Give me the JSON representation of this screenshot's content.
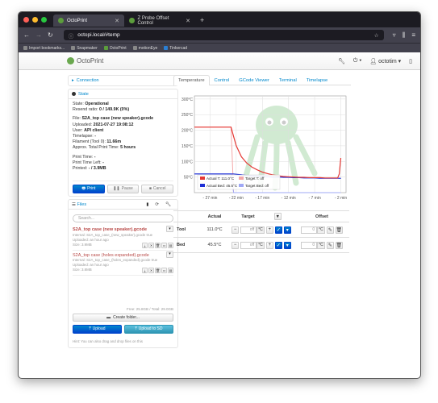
{
  "browser": {
    "tabs": [
      {
        "label": "OctoPrint"
      },
      {
        "label": "Z Probe Offset Control"
      }
    ],
    "url": "octopi.local/#temp",
    "bookmarks": [
      "Import bookmarks...",
      "Snapmaker",
      "OctoPrint",
      "motionEye",
      "Tinkercad"
    ]
  },
  "header": {
    "brand": "OctoPrint",
    "user": "octotim"
  },
  "sidebar": {
    "connection_title": "Connection",
    "state_title": "State",
    "state_lines": [
      {
        "label": "State: ",
        "value": "Operational"
      },
      {
        "label": "Resend ratio: ",
        "value": "0 / 149.9K (0%)"
      }
    ],
    "file_lines": [
      {
        "label": "File: ",
        "value": "S2A_top case (new speaker).gcode"
      },
      {
        "label": "Uploaded: ",
        "value": "2021-07-27 19:08:12"
      },
      {
        "label": "User: ",
        "value": "API client"
      },
      {
        "label": "Timelapse: ",
        "value": "-"
      },
      {
        "label": "Filament (Tool 0): ",
        "value": "11.66m"
      },
      {
        "label": "Approx. Total Print Time: ",
        "value": "5 hours"
      }
    ],
    "time_lines": [
      {
        "label": "Print Time: ",
        "value": "-"
      },
      {
        "label": "Print Time Left: ",
        "value": "-"
      },
      {
        "label": "Printed: ",
        "value": "- / 3.9MB"
      }
    ],
    "print_btn": "Print",
    "pause_btn": "Pause",
    "cancel_btn": "Cancel",
    "files_title": "Files",
    "search_placeholder": "Search...",
    "files": [
      {
        "name": "S2A_top case (new speaker).gcode",
        "internal": "Internal: S2A_top_case_(new_speaker).gcode true",
        "uploaded": "Uploaded: an hour ago",
        "size": "Size: 3.9MB"
      },
      {
        "name": "S2A_top case (holes expanded).gcode",
        "internal": "Internal: S2A_top_case_(holes_expanded).gcode true",
        "uploaded": "Uploaded: an hour ago",
        "size": "Size: 3.8MB"
      }
    ],
    "free_space": "Free: 25.8GB / Total: 29.0GB",
    "create_folder": "Create folder...",
    "upload_btn": "Upload",
    "upload_sd_btn": "Upload to SD",
    "hint": "Hint: You can also drag and drop files on this"
  },
  "tabs": [
    "Temperature",
    "Control",
    "GCode Viewer",
    "Terminal",
    "Timelapse"
  ],
  "chart_data": {
    "type": "line",
    "x": [
      -30,
      -29,
      -28,
      -27,
      -26,
      -25,
      -24,
      -23,
      -22.5,
      -22,
      -21,
      -20,
      -19,
      -18,
      -17,
      -16,
      -15,
      -14,
      -13,
      -12,
      -11,
      -10,
      -9,
      -8,
      -7,
      -6,
      -5,
      -4,
      -3,
      -2.6,
      -2.3,
      -2
    ],
    "series": [
      {
        "name": "Actual T: 111.0°C",
        "color": "#e53935",
        "values": [
          210,
          210,
          210,
          210,
          210,
          210,
          210,
          210,
          180,
          150,
          115,
          95,
          82,
          73,
          66,
          61,
          57,
          54,
          52,
          51,
          50,
          49,
          49,
          48,
          48,
          48,
          47,
          47,
          47,
          47,
          60,
          111
        ]
      },
      {
        "name": "Target T: off",
        "color": "#f4a8a8",
        "values": [
          210,
          210,
          210,
          210,
          210,
          210,
          210,
          210,
          0,
          0,
          0,
          0,
          0,
          0,
          0,
          0,
          0,
          0,
          0,
          0,
          0,
          0,
          0,
          0,
          0,
          0,
          0,
          0,
          0,
          0,
          0,
          0
        ]
      },
      {
        "name": "Actual Bed: 45.5°C",
        "color": "#1e2fd6",
        "values": [
          60,
          60,
          60,
          60,
          60,
          60,
          60,
          60,
          60,
          59,
          57,
          55,
          54,
          53,
          52,
          51,
          50,
          50,
          49,
          49,
          48,
          48,
          47,
          47,
          47,
          46,
          46,
          46,
          46,
          46,
          46,
          45.5
        ]
      },
      {
        "name": "Target Bed: off",
        "color": "#9fa8f5",
        "values": [
          60,
          60,
          60,
          60,
          60,
          60,
          60,
          60,
          0,
          0,
          0,
          0,
          0,
          0,
          0,
          0,
          0,
          0,
          0,
          0,
          0,
          0,
          0,
          0,
          0,
          0,
          0,
          0,
          0,
          0,
          0,
          0
        ]
      }
    ],
    "yticks": [
      "300°C",
      "250°C",
      "200°C",
      "150°C",
      "100°C",
      "50°C"
    ],
    "ytick_values": [
      300,
      250,
      200,
      150,
      100,
      50
    ],
    "xticks": [
      "- 27 min",
      "- 22 min",
      "- 17 min",
      "- 12 min",
      "- 7 min",
      "- 2 min"
    ],
    "xtick_values": [
      -27,
      -22,
      -17,
      -12,
      -7,
      -2
    ],
    "xlim": [
      -30,
      -1
    ],
    "ylim": [
      0,
      310
    ],
    "grid": true,
    "legend_position": "bottom-left"
  },
  "temp_table": {
    "headers": [
      "Actual",
      "Target",
      "Offset"
    ],
    "rows": [
      {
        "name": "Tool",
        "actual": "111.0°C",
        "target": "off",
        "offset": "0"
      },
      {
        "name": "Bed",
        "actual": "45.5°C",
        "target": "off",
        "offset": "0"
      }
    ],
    "unit": "°C"
  }
}
